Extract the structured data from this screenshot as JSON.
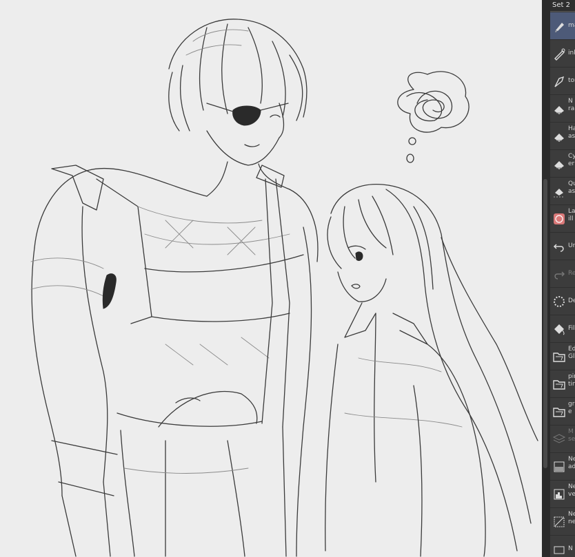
{
  "panel": {
    "set_tab": "Set 2",
    "items": [
      {
        "label": "ma",
        "icon": "pen-nib-icon",
        "active": true
      },
      {
        "label": "ink",
        "icon": "ink-pen-icon"
      },
      {
        "label": "tor",
        "icon": "pen-tip-icon"
      },
      {
        "label": "N\nra",
        "icon": "eraser-icon"
      },
      {
        "label": "Ha\nas",
        "icon": "eraser-icon"
      },
      {
        "label": "Cy\ner",
        "icon": "eraser-icon"
      },
      {
        "label": "Qu\nass",
        "icon": "quick-eraser-icon"
      },
      {
        "label": "La\nill",
        "icon": "layer-color-icon"
      },
      {
        "label": "Ur",
        "icon": "undo-icon"
      },
      {
        "label": "Re",
        "icon": "redo-icon",
        "dim": true
      },
      {
        "label": "De",
        "icon": "deselect-icon"
      },
      {
        "label": "Fil",
        "icon": "fill-icon"
      },
      {
        "label": "Ed\nGl",
        "icon": "folder-icon"
      },
      {
        "label": "pin\ntin",
        "icon": "folder-icon"
      },
      {
        "label": "gr\ne",
        "icon": "folder-icon"
      },
      {
        "label": "M\nsel",
        "icon": "layers-icon",
        "dim": true
      },
      {
        "label": "Ne\nadj",
        "icon": "gradient-layer-icon"
      },
      {
        "label": "Ne\nvel",
        "icon": "levels-layer-icon"
      },
      {
        "label": "Ne\nne",
        "icon": "curves-layer-icon"
      },
      {
        "label": "N",
        "icon": "layer-icon"
      }
    ]
  }
}
